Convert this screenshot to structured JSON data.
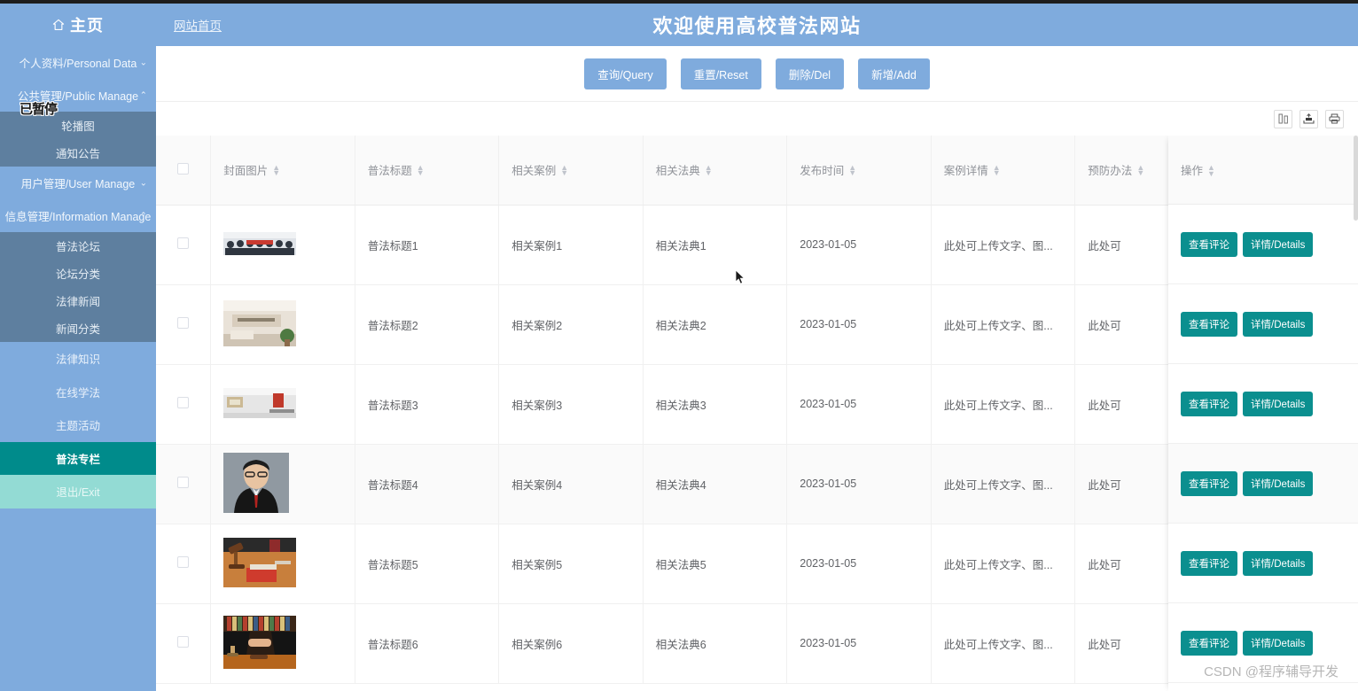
{
  "header": {
    "brand": "主页",
    "brand_icon": "home-icon",
    "nav_link": "网站首页",
    "title": "欢迎使用高校普法网站"
  },
  "sidebar": {
    "overlay_badge": "已暂停",
    "groups": [
      {
        "label": "个人资料/Personal Data",
        "caret": "chevron-down-icon",
        "expanded": false,
        "items": []
      },
      {
        "label": "公共管理/Public Manage",
        "caret": "chevron-up-icon",
        "expanded": true,
        "items": [
          {
            "label": "轮播图",
            "state": "normal"
          },
          {
            "label": "通知公告",
            "state": "normal"
          }
        ]
      },
      {
        "label": "用户管理/User Manage",
        "caret": "chevron-down-icon",
        "expanded": false,
        "items": []
      },
      {
        "label": "信息管理/Information Manage",
        "caret": "chevron-up-icon",
        "expanded": true,
        "items": [
          {
            "label": "普法论坛",
            "state": "normal"
          },
          {
            "label": "论坛分类",
            "state": "normal"
          },
          {
            "label": "法律新闻",
            "state": "normal"
          },
          {
            "label": "新闻分类",
            "state": "normal"
          }
        ]
      }
    ],
    "plain_items": [
      {
        "label": "法律知识",
        "state": "normal"
      },
      {
        "label": "在线学法",
        "state": "normal"
      },
      {
        "label": "主题活动",
        "state": "normal"
      },
      {
        "label": "普法专栏",
        "state": "active"
      },
      {
        "label": "退出/Exit",
        "state": "exit"
      }
    ]
  },
  "toolbar": {
    "buttons": [
      {
        "label": "查询/Query",
        "name": "query-button"
      },
      {
        "label": "重置/Reset",
        "name": "reset-button"
      },
      {
        "label": "删除/Del",
        "name": "delete-button"
      },
      {
        "label": "新增/Add",
        "name": "add-button"
      }
    ]
  },
  "table_tools": [
    {
      "name": "column-settings-icon",
      "title": "列设置"
    },
    {
      "name": "export-icon",
      "title": "导出"
    },
    {
      "name": "print-icon",
      "title": "打印"
    }
  ],
  "table": {
    "columns": [
      {
        "key": "check",
        "label": "",
        "sortable": false
      },
      {
        "key": "image",
        "label": "封面图片",
        "sortable": true
      },
      {
        "key": "title",
        "label": "普法标题",
        "sortable": true
      },
      {
        "key": "case",
        "label": "相关案例",
        "sortable": true
      },
      {
        "key": "code",
        "label": "相关法典",
        "sortable": true
      },
      {
        "key": "time",
        "label": "发布时间",
        "sortable": true
      },
      {
        "key": "detail",
        "label": "案例详情",
        "sortable": true
      },
      {
        "key": "prev",
        "label": "预防办法",
        "sortable": true
      },
      {
        "key": "op",
        "label": "操作",
        "sortable": true
      }
    ],
    "row_actions": [
      {
        "label": "查看评论",
        "name": "view-comments-button"
      },
      {
        "label": "详情/Details",
        "name": "details-button"
      }
    ],
    "rows": [
      {
        "title": "普法标题1",
        "case": "相关案例1",
        "code": "相关法典1",
        "time": "2023-01-05",
        "detail": "此处可上传文字、图...",
        "prev": "此处可",
        "hover": false,
        "thumb": "group-photo"
      },
      {
        "title": "普法标题2",
        "case": "相关案例2",
        "code": "相关法典2",
        "time": "2023-01-05",
        "detail": "此处可上传文字、图...",
        "prev": "此处可",
        "hover": false,
        "thumb": "office-lobby"
      },
      {
        "title": "普法标题3",
        "case": "相关案例3",
        "code": "相关法典3",
        "time": "2023-01-05",
        "detail": "此处可上传文字、图...",
        "prev": "此处可",
        "hover": false,
        "thumb": "office-interior"
      },
      {
        "title": "普法标题4",
        "case": "相关案例4",
        "code": "相关法典4",
        "time": "2023-01-05",
        "detail": "此处可上传文字、图...",
        "prev": "此处可",
        "hover": true,
        "thumb": "lawyer-portrait"
      },
      {
        "title": "普法标题5",
        "case": "相关案例5",
        "code": "相关法典5",
        "time": "2023-01-05",
        "detail": "此处可上传文字、图...",
        "prev": "此处可",
        "hover": false,
        "thumb": "gavel-desk"
      },
      {
        "title": "普法标题6",
        "case": "相关案例6",
        "code": "相关法典6",
        "time": "2023-01-05",
        "detail": "此处可上传文字、图...",
        "prev": "此处可",
        "hover": false,
        "thumb": "handshake-court"
      }
    ]
  },
  "watermark": "CSDN @程序辅导开发",
  "colors": {
    "header_blue": "#7fabdd",
    "submenu_blue": "#5e7f9f",
    "active_teal": "#008b8b",
    "exit_mint": "#93dbd4",
    "action_teal": "#0b8f8f",
    "row_hover": "#fafafa"
  }
}
